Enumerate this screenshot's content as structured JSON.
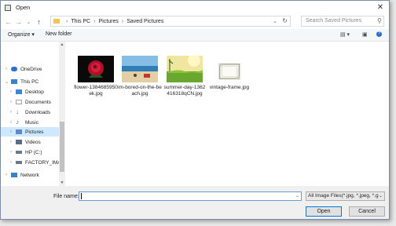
{
  "window": {
    "title": "Open",
    "close": "✕"
  },
  "nav": {
    "back": "←",
    "forward": "→",
    "dropdown": "⌄",
    "up": "↑",
    "breadcrumb": [
      "This PC",
      "Pictures",
      "Saved Pictures"
    ],
    "separator": "›",
    "search_placeholder": "Search Saved Pictures"
  },
  "toolbar": {
    "organize": "Organize ▾",
    "new_folder": "New folder"
  },
  "sidebar": {
    "items": [
      {
        "label": "OneDrive",
        "icon": "cloud-icon",
        "color": "#2a72c9"
      },
      {
        "label": "This PC",
        "icon": "computer-icon",
        "color": "#3b82c4"
      },
      {
        "label": "Desktop",
        "icon": "desktop-icon",
        "color": "#3f84d6"
      },
      {
        "label": "Documents",
        "icon": "documents-icon",
        "color": "#9aa3ad"
      },
      {
        "label": "Downloads",
        "icon": "download-icon",
        "color": "#2d6fc4"
      },
      {
        "label": "Music",
        "icon": "music-icon",
        "color": "#2d6fc4"
      },
      {
        "label": "Pictures",
        "icon": "pictures-icon",
        "color": "#5a8bc5"
      },
      {
        "label": "Videos",
        "icon": "videos-icon",
        "color": "#5a6c84"
      },
      {
        "label": "HP (C:)",
        "icon": "drive-icon",
        "color": "#6a7a8a"
      },
      {
        "label": "FACTORY_IMAG",
        "icon": "drive-icon",
        "color": "#6a7a8a"
      },
      {
        "label": "Network",
        "icon": "network-icon",
        "color": "#3b82c4"
      }
    ]
  },
  "files": [
    {
      "name": "flower-1384685950ek.jpg",
      "thumbnail": "rose-flower-thumbnail"
    },
    {
      "name": "im-bored-on-the-beach.jpg",
      "thumbnail": "beach-thumbnail"
    },
    {
      "name": "summer-day-1362416318qCN.jpg",
      "thumbnail": "summer-field-thumbnail"
    },
    {
      "name": "vintage-frame.jpg",
      "thumbnail": "vintage-frame-thumbnail"
    }
  ],
  "footer": {
    "file_name_label": "File name:",
    "file_name_value": "",
    "filter": "All Image Files(*.jpg, *.jpeg, *.g",
    "open": "Open",
    "cancel": "Cancel"
  }
}
